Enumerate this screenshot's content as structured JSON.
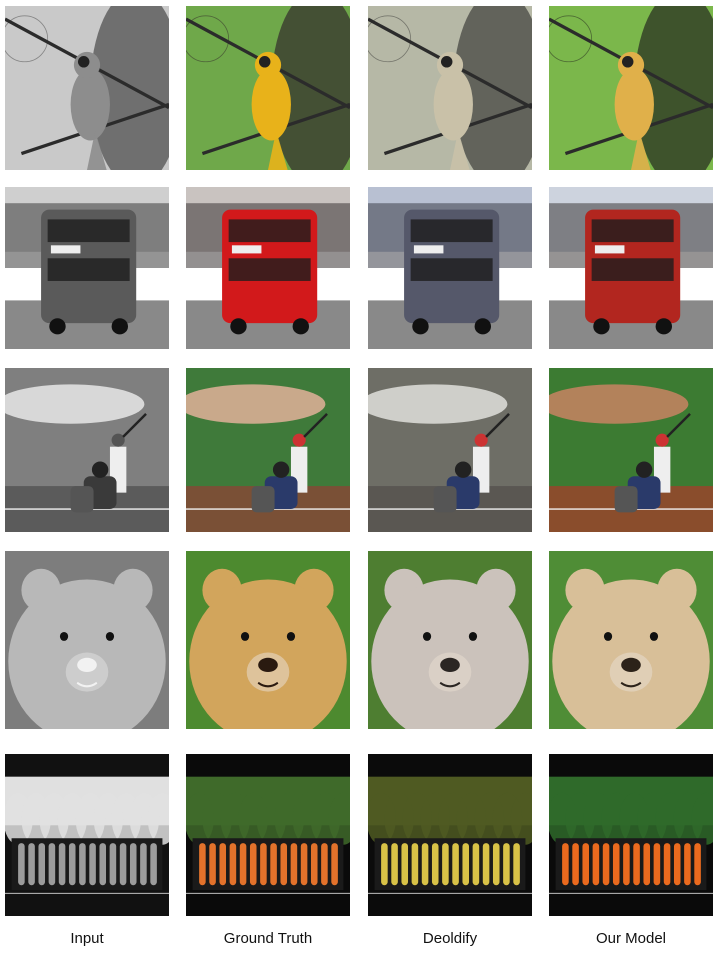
{
  "columns": [
    {
      "label": "Input",
      "treatment": "grayscale"
    },
    {
      "label": "Ground Truth",
      "treatment": "ground-truth-color"
    },
    {
      "label": "Deoldify",
      "treatment": "desaturated-color"
    },
    {
      "label": "Our Model",
      "treatment": "model-color"
    }
  ],
  "rows": [
    {
      "subject": "bird-on-branch",
      "colors": {
        "gray": "#8d8d8d",
        "gt": "#e8b21a",
        "deoldify": "#c9c1a8",
        "model": "#e0b04a"
      }
    },
    {
      "subject": "red-double-decker-bus",
      "colors": {
        "gray": "#5a5a5a",
        "gt": "#d2191b",
        "deoldify": "#55586a",
        "model": "#b2261f"
      }
    },
    {
      "subject": "baseball-batter",
      "colors": {
        "gray": "#7f7f7f",
        "gt": "#3f7a3a",
        "deoldify": "#6e6e66",
        "model": "#3c7b32"
      }
    },
    {
      "subject": "brown-bear",
      "colors": {
        "gray": "#b8b8b8",
        "gt": "#d2a55c",
        "deoldify": "#cbc2bb",
        "model": "#d8bf98"
      }
    },
    {
      "subject": "carrots-at-market",
      "colors": {
        "gray": "#9c9c9c",
        "gt": "#e3722b",
        "deoldify": "#d8c247",
        "model": "#eb6a1e"
      }
    }
  ]
}
